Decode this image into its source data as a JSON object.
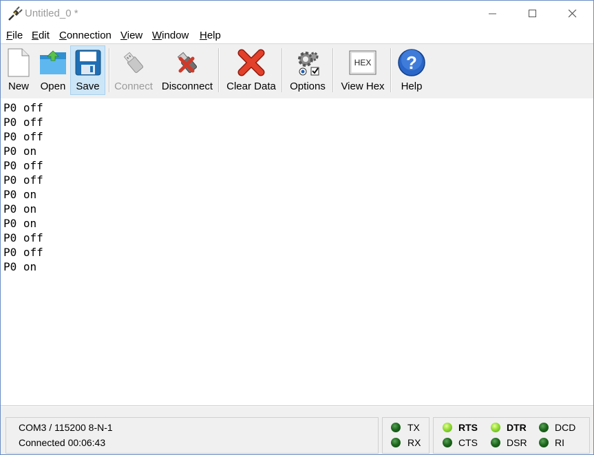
{
  "window": {
    "title": "Untitled_0 *"
  },
  "menu": [
    {
      "accel": "F",
      "rest": "ile"
    },
    {
      "accel": "E",
      "rest": "dit"
    },
    {
      "accel": "C",
      "rest": "onnection"
    },
    {
      "accel": "V",
      "rest": "iew"
    },
    {
      "accel": "W",
      "rest": "indow"
    },
    {
      "accel": "H",
      "rest": "elp"
    }
  ],
  "toolbar": {
    "new": "New",
    "open": "Open",
    "save": "Save",
    "connect": "Connect",
    "disconnect": "Disconnect",
    "clear": "Clear Data",
    "options": "Options",
    "viewhex": "View Hex",
    "hex_icon_text": "HEX",
    "help": "Help"
  },
  "terminal": {
    "lines": [
      "P0 off",
      "P0 off",
      "P0 off",
      "P0 on",
      "P0 off",
      "P0 off",
      "P0 on",
      "P0 on",
      "P0 on",
      "P0 off",
      "P0 off",
      "P0 on"
    ]
  },
  "status": {
    "port": "COM3 / 115200 8-N-1",
    "connection": "Connected 00:06:43",
    "tx": "TX",
    "rx": "RX",
    "rts": "RTS",
    "cts": "CTS",
    "dtr": "DTR",
    "dsr": "DSR",
    "dcd": "DCD",
    "ri": "RI"
  },
  "colors": {
    "led_on": "#9be03a",
    "led_off": "#1e6a1e",
    "toolbar_bg": "#f0f0f0",
    "title_inactive": "#9a9a9a"
  }
}
